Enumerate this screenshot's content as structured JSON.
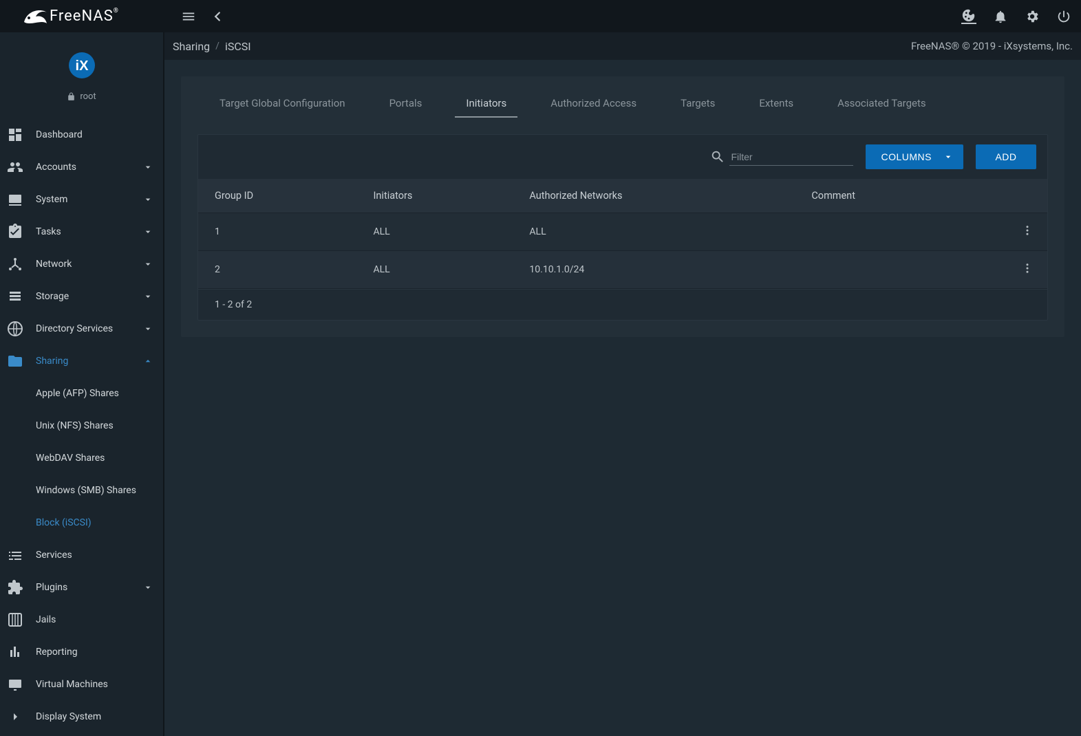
{
  "brand": "FreeNAS",
  "user": "root",
  "breadcrumb": {
    "parent": "Sharing",
    "current": "iSCSI"
  },
  "copyright": "FreeNAS® © 2019 - iXsystems, Inc.",
  "sidebar": {
    "items": [
      {
        "label": "Dashboard",
        "expandable": false
      },
      {
        "label": "Accounts",
        "expandable": true
      },
      {
        "label": "System",
        "expandable": true
      },
      {
        "label": "Tasks",
        "expandable": true
      },
      {
        "label": "Network",
        "expandable": true
      },
      {
        "label": "Storage",
        "expandable": true
      },
      {
        "label": "Directory Services",
        "expandable": true
      },
      {
        "label": "Sharing",
        "expandable": true,
        "active": true,
        "expanded": true
      },
      {
        "label": "Services",
        "expandable": false
      },
      {
        "label": "Plugins",
        "expandable": true
      },
      {
        "label": "Jails",
        "expandable": false
      },
      {
        "label": "Reporting",
        "expandable": false
      },
      {
        "label": "Virtual Machines",
        "expandable": false
      },
      {
        "label": "Display System",
        "expandable": false
      }
    ],
    "sharing_children": [
      {
        "label": "Apple (AFP) Shares"
      },
      {
        "label": "Unix (NFS) Shares"
      },
      {
        "label": "WebDAV Shares"
      },
      {
        "label": "Windows (SMB) Shares"
      },
      {
        "label": "Block (iSCSI)",
        "active": true
      }
    ]
  },
  "tabs": [
    "Target Global Configuration",
    "Portals",
    "Initiators",
    "Authorized Access",
    "Targets",
    "Extents",
    "Associated Targets"
  ],
  "active_tab_index": 2,
  "toolbar": {
    "filter_placeholder": "Filter",
    "columns_label": "COLUMNS",
    "add_label": "ADD"
  },
  "table": {
    "headers": [
      "Group ID",
      "Initiators",
      "Authorized Networks",
      "Comment"
    ],
    "rows": [
      {
        "group_id": "1",
        "initiators": "ALL",
        "networks": "ALL",
        "comment": ""
      },
      {
        "group_id": "2",
        "initiators": "ALL",
        "networks": "10.10.1.0/24",
        "comment": ""
      }
    ],
    "pagination": "1 - 2 of 2"
  }
}
